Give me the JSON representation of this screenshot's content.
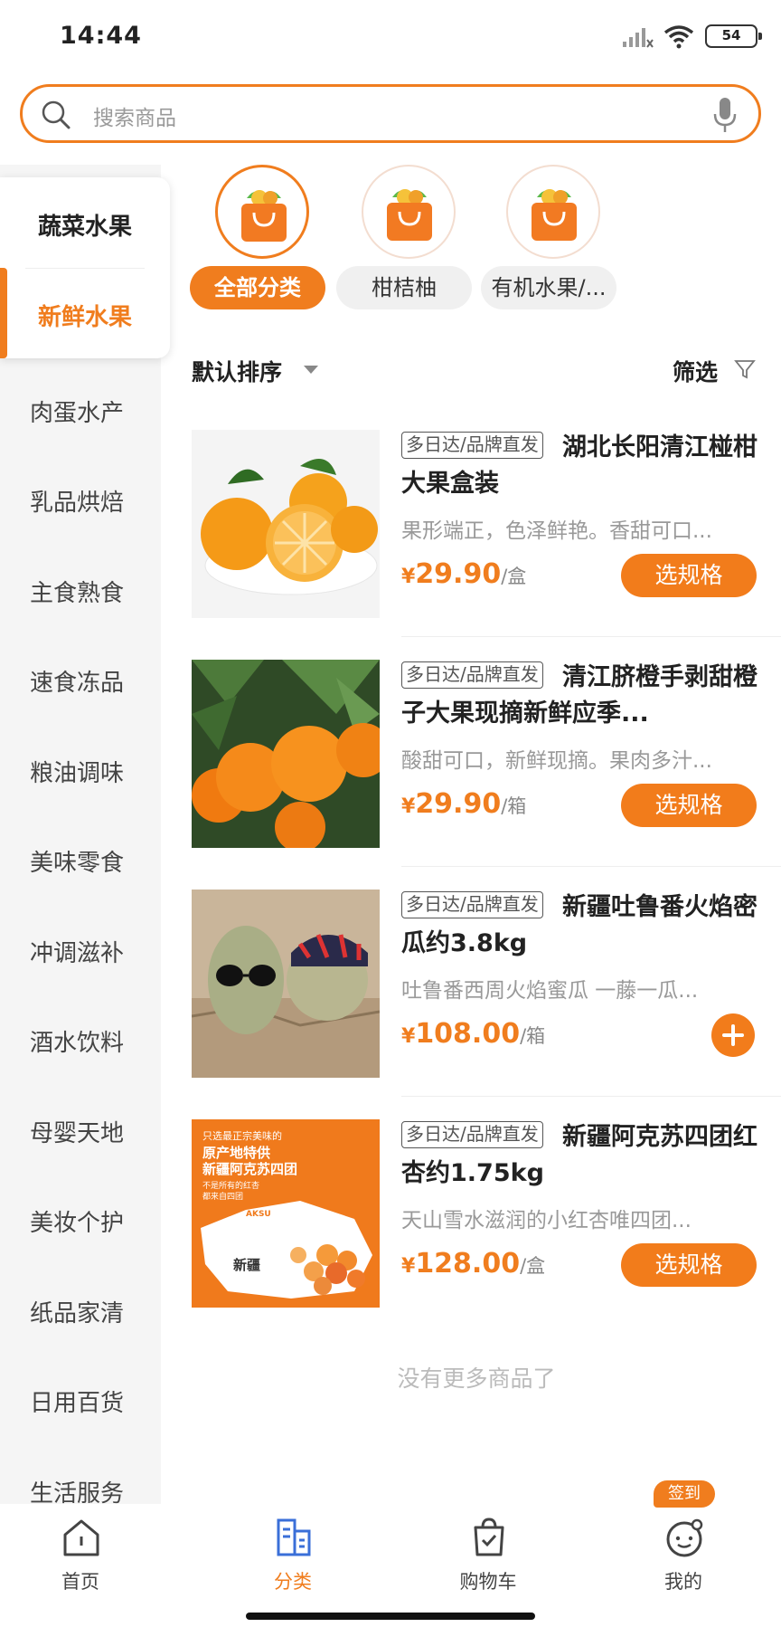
{
  "status_bar": {
    "time": "14:44",
    "battery": "54"
  },
  "search": {
    "placeholder": "搜索商品"
  },
  "sidebar": {
    "group_title": "蔬菜水果",
    "active_item": "新鲜水果",
    "items": [
      "肉蛋水产",
      "乳品烘焙",
      "主食熟食",
      "速食冻品",
      "粮油调味",
      "美味零食",
      "冲调滋补",
      "酒水饮料",
      "母婴天地",
      "美妆个护",
      "纸品家清",
      "日用百货",
      "生活服务"
    ]
  },
  "subcategories": [
    {
      "label": "全部分类",
      "active": true,
      "icon": "shopping-bag-icon"
    },
    {
      "label": "柑桔柚",
      "active": false,
      "icon": "shopping-bag-icon"
    },
    {
      "label": "有机水果/...",
      "active": false,
      "icon": "shopping-bag-icon"
    }
  ],
  "sort": {
    "label": "默认排序",
    "filter_label": "筛选"
  },
  "products": [
    {
      "tag": "多日达/品牌直发",
      "title": "湖北长阳清江椪柑大果盒装",
      "desc": "果形端正，色泽鲜艳。香甜可口...",
      "currency": "¥",
      "price": "29.90",
      "unit": "/盒",
      "action": "选规格"
    },
    {
      "tag": "多日达/品牌直发",
      "title": "清江脐橙手剥甜橙子大果现摘新鲜应季...",
      "desc": "酸甜可口，新鲜现摘。果肉多汁...",
      "currency": "¥",
      "price": "29.90",
      "unit": "/箱",
      "action": "选规格"
    },
    {
      "tag": "多日达/品牌直发",
      "title": "新疆吐鲁番火焰密瓜约3.8kg",
      "desc": "吐鲁番西周火焰蜜瓜 一藤一瓜...",
      "currency": "¥",
      "price": "108.00",
      "unit": "/箱",
      "action": "+"
    },
    {
      "tag": "多日达/品牌直发",
      "title": "新疆阿克苏四团红杏约1.75kg",
      "desc": "天山雪水滋润的小红杏唯四团...",
      "currency": "¥",
      "price": "128.00",
      "unit": "/盒",
      "action": "选规格"
    }
  ],
  "apricot_banner": {
    "line1": "只选最正宗美味的",
    "line2": "原产地特供",
    "line3": "新疆阿克苏四团",
    "line4": "不是所有的红杏",
    "line5": "都来自四团",
    "logo": "AKSU",
    "region": "新疆"
  },
  "no_more": "没有更多商品了",
  "tabbar": {
    "tabs": [
      {
        "label": "首页",
        "icon": "home-icon"
      },
      {
        "label": "分类",
        "icon": "category-icon",
        "active": true
      },
      {
        "label": "购物车",
        "icon": "cart-icon"
      },
      {
        "label": "我的",
        "icon": "profile-icon"
      }
    ],
    "badge": "签到"
  },
  "colors": {
    "accent": "#f07d1e",
    "muted": "#999999"
  }
}
